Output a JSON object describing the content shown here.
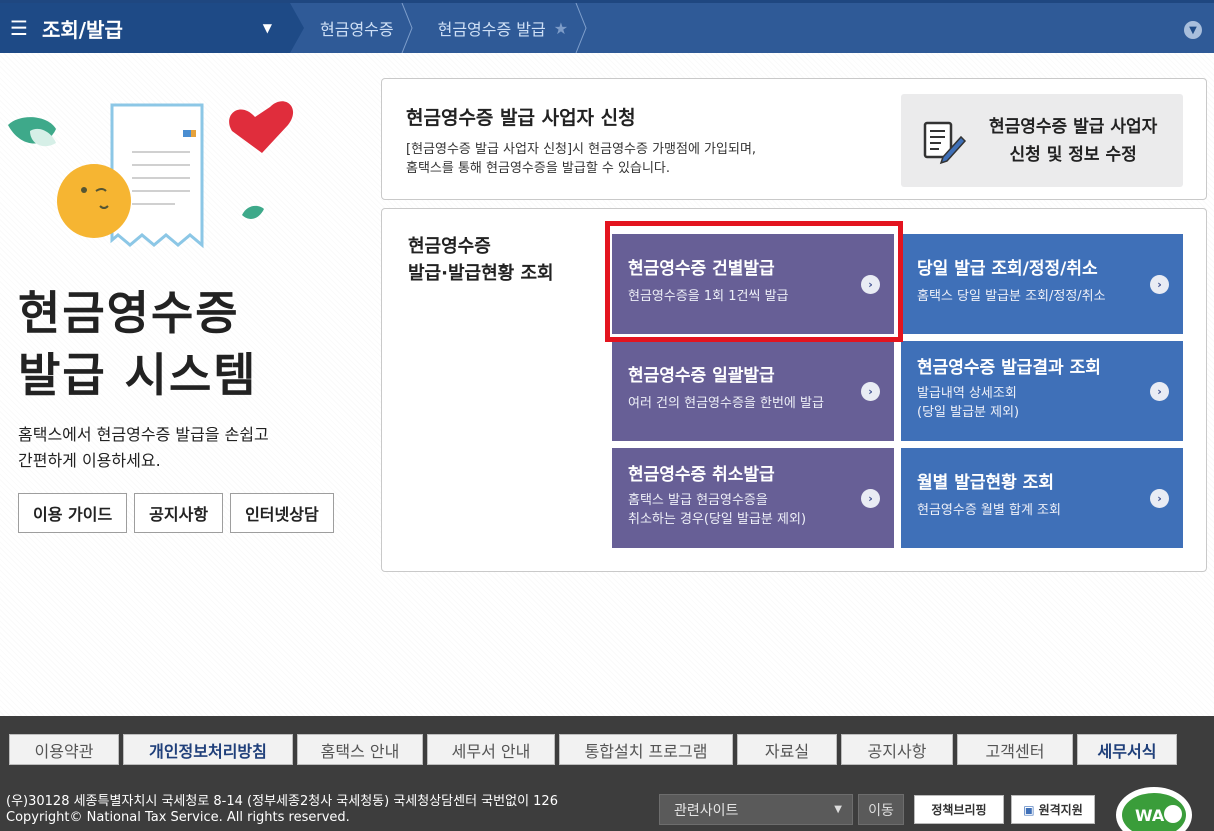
{
  "topnav": {
    "menu_title": "조회/발급",
    "crumbs": [
      "현금영수증",
      "현금영수증 발급"
    ]
  },
  "hero": {
    "title_line1": "현금영수증",
    "title_line2": "발급 시스템",
    "desc_line1": "홈택스에서 현금영수증 발급을 손쉽고",
    "desc_line2": "간편하게 이용하세요.",
    "buttons": [
      "이용 가이드",
      "공지사항",
      "인터넷상담"
    ]
  },
  "apply_panel": {
    "title": "현금영수증 발급 사업자 신청",
    "desc_line1": "[현금영수증 발급 사업자 신청]시 현금영수증 가맹점에 가입되며,",
    "desc_line2": "홈택스를 통해 현금영수증을 발급할 수 있습니다.",
    "action_line1": "현금영수증 발급 사업자",
    "action_line2": "신청 및 정보 수정"
  },
  "main_panel": {
    "title_line1": "현금영수증",
    "title_line2": "발급·발급현황 조회",
    "tiles": [
      {
        "title": "현금영수증 건별발급",
        "desc": "현금영수증을 1회 1건씩 발급",
        "desc2": ""
      },
      {
        "title": "당일 발급 조회/정정/취소",
        "desc": "홈택스 당일 발급분 조회/정정/취소",
        "desc2": ""
      },
      {
        "title": "현금영수증 일괄발급",
        "desc": "여러 건의 현금영수증을 한번에 발급",
        "desc2": ""
      },
      {
        "title": "현금영수증 발급결과 조회",
        "desc": "발급내역 상세조회",
        "desc2": "(당일 발급분 제외)"
      },
      {
        "title": "현금영수증 취소발급",
        "desc": "홈택스 발급 현금영수증을",
        "desc2": "취소하는 경우(당일 발급분 제외)"
      },
      {
        "title": "월별 발급현황 조회",
        "desc": "현금영수증 월별 합계 조회",
        "desc2": ""
      }
    ]
  },
  "footer": {
    "links": [
      "이용약관",
      "개인정보처리방침",
      "홈택스 안내",
      "세무서 안내",
      "통합설치 프로그램",
      "자료실",
      "공지사항",
      "고객센터",
      "세무서식"
    ],
    "address": "(우)30128 세종특별자치시 국세청로 8-14 (정부세종2청사 국세청동) 국세청상담센터 국번없이 126",
    "copyright": "Copyright© National Tax Service. All rights reserved.",
    "related_sites": "관련사이트",
    "move": "이동",
    "policy_logo": "정책브리핑",
    "remote_support": "원격지원",
    "wa_mark": "WA"
  },
  "colors": {
    "nav": "#2f5a97",
    "tile_purple": "#675f96",
    "tile_blue": "#3f70b8",
    "highlight": "#e3141f",
    "footer": "#3d3d3d"
  }
}
